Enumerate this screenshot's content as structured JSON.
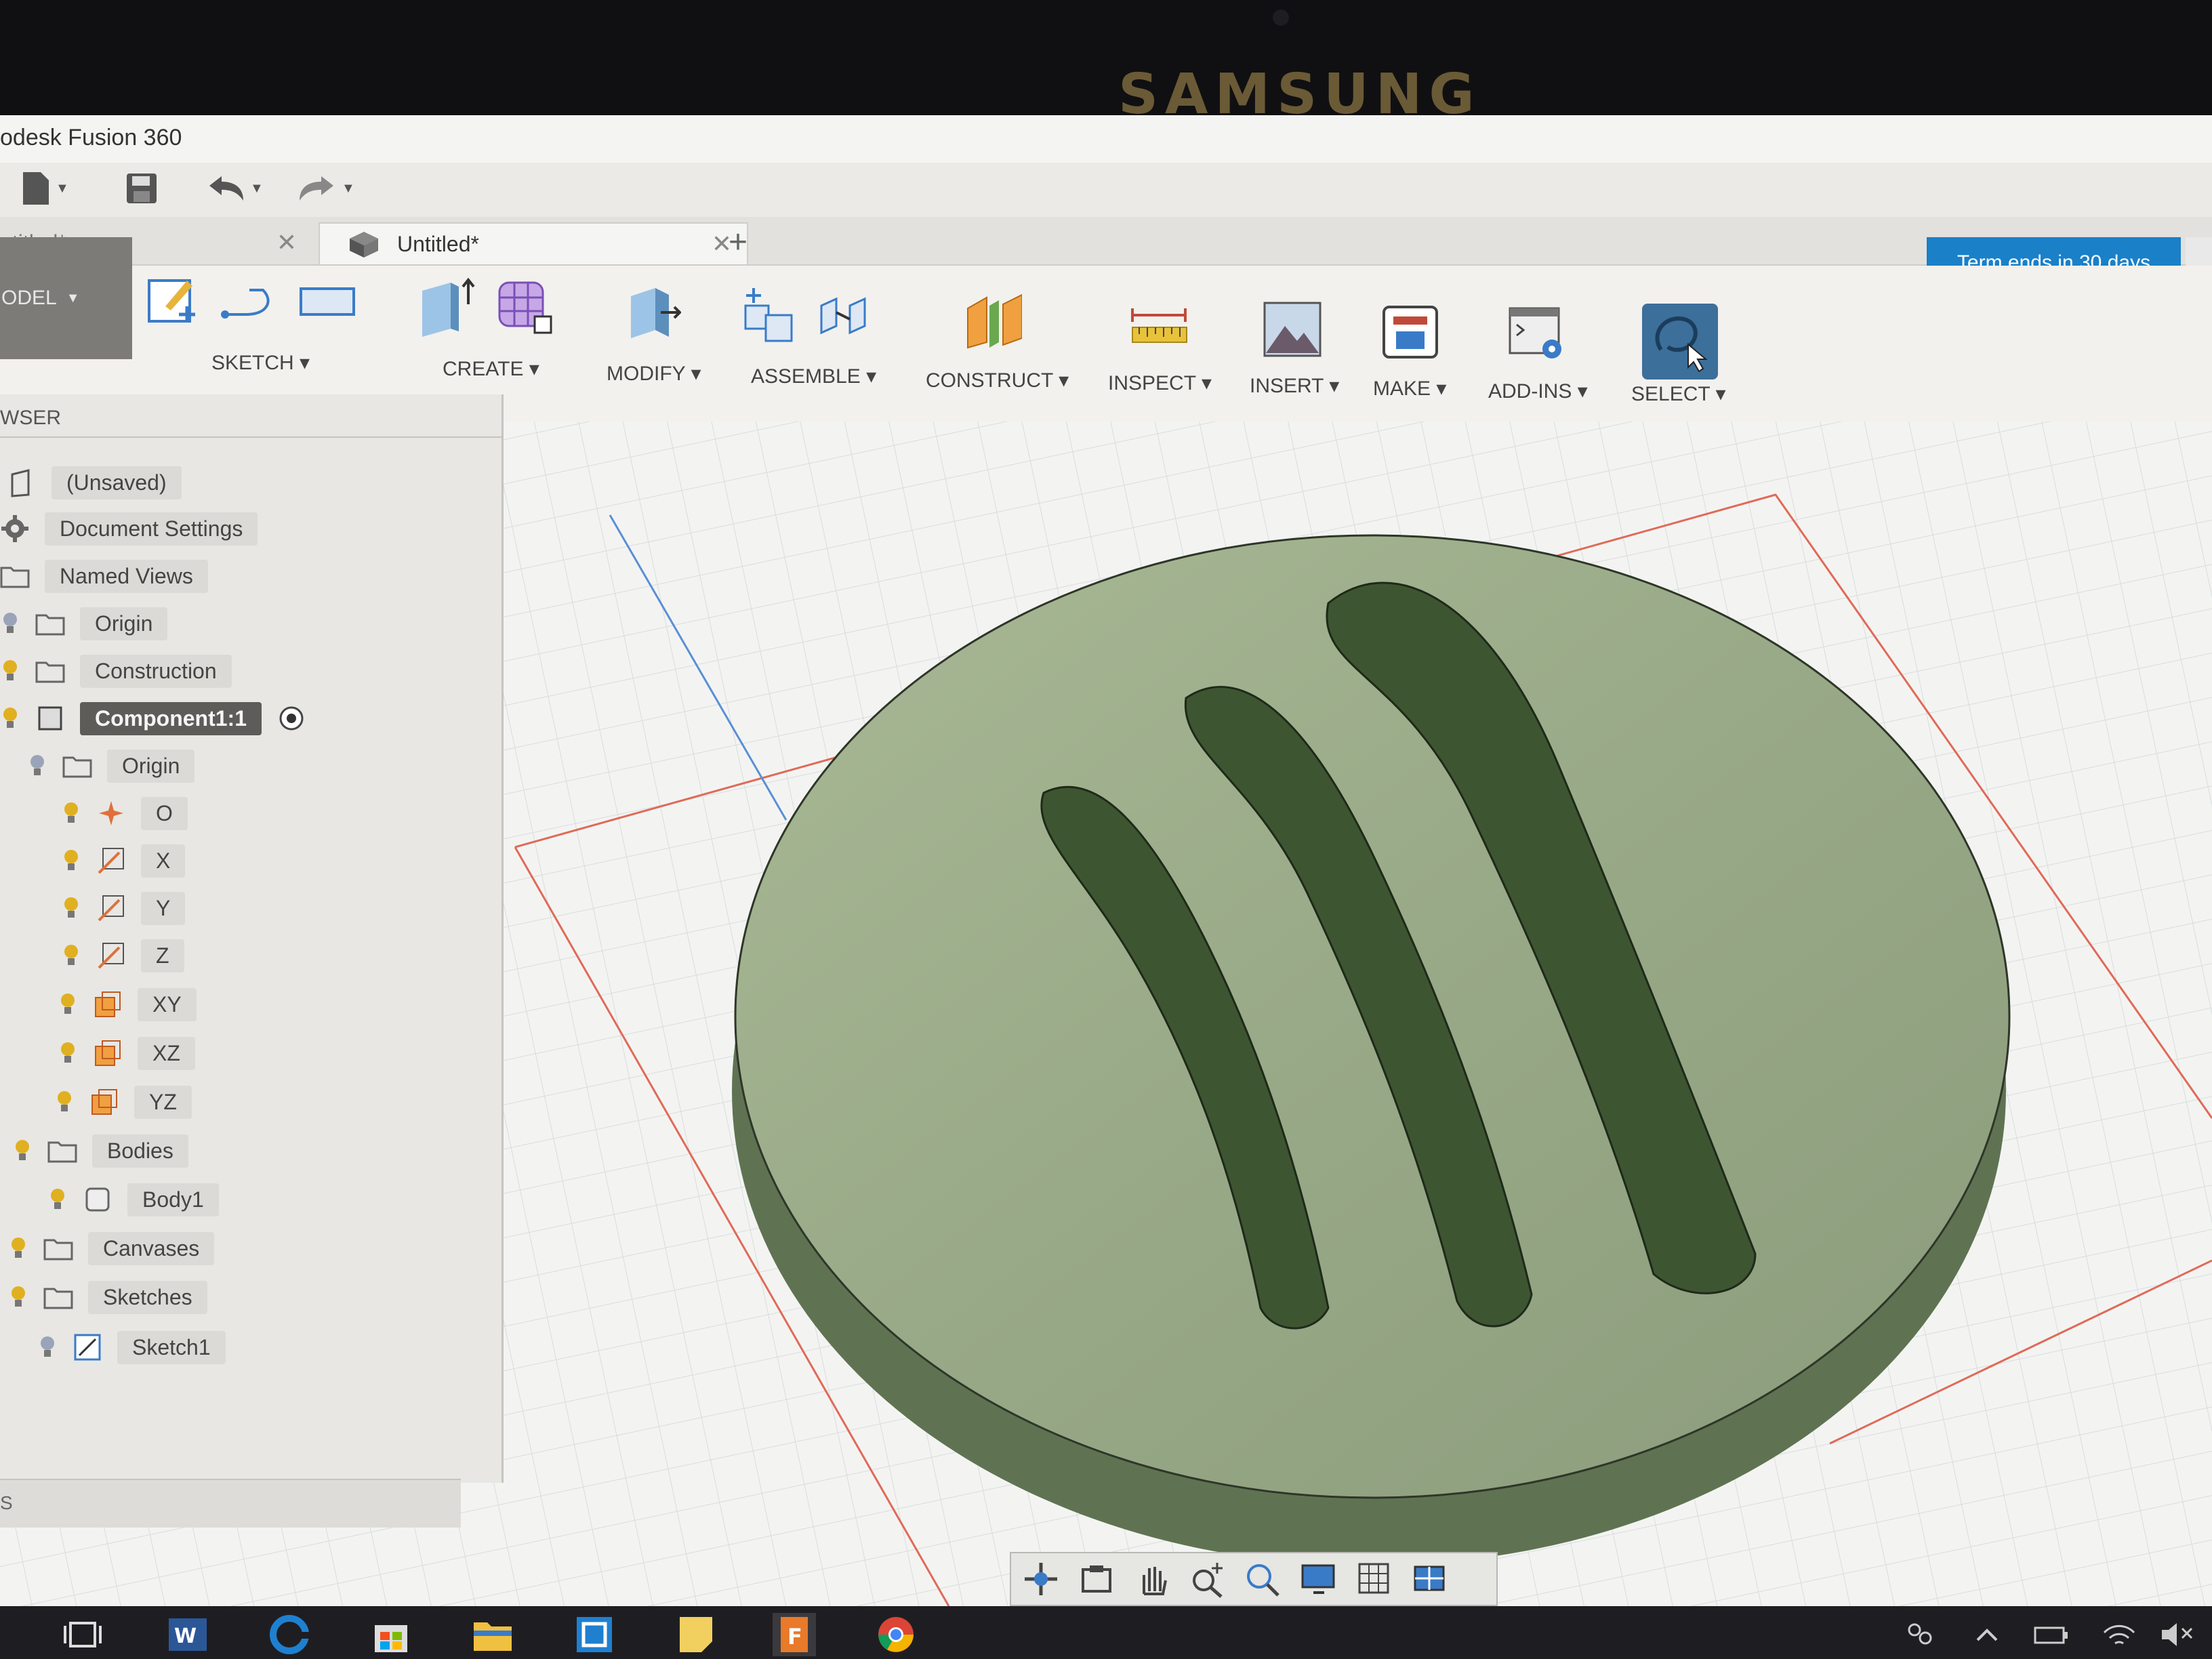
{
  "device": {
    "brand": "SAMSUNG"
  },
  "window": {
    "title": "odesk Fusion 360"
  },
  "quick_access": {
    "icons": [
      "file-menu-icon",
      "save-icon",
      "undo-icon",
      "redo-icon"
    ]
  },
  "tabs": [
    {
      "label": "ntitled*",
      "active": false
    },
    {
      "label": "Untitled*",
      "active": true
    }
  ],
  "trial_badge": "Term ends in 30 days",
  "workspace": {
    "label": "ODEL"
  },
  "toolbar": {
    "groups": [
      {
        "label": "SKETCH"
      },
      {
        "label": "CREATE"
      },
      {
        "label": "MODIFY"
      },
      {
        "label": "ASSEMBLE"
      },
      {
        "label": "CONSTRUCT"
      },
      {
        "label": "INSPECT"
      },
      {
        "label": "INSERT"
      },
      {
        "label": "MAKE"
      },
      {
        "label": "ADD-INS"
      },
      {
        "label": "SELECT"
      }
    ]
  },
  "browser": {
    "header": "WSER",
    "footer": "S",
    "items": [
      {
        "label": "(Unsaved)",
        "icon": "document-icon"
      },
      {
        "label": "Document Settings",
        "icon": "gear-icon"
      },
      {
        "label": "Named Views",
        "icon": "folder-icon"
      },
      {
        "label": "Origin",
        "icon": "folder-icon"
      },
      {
        "label": "Construction",
        "icon": "folder-icon"
      },
      {
        "label": "Component1:1",
        "icon": "component-icon",
        "active": true
      },
      {
        "label": "Origin",
        "icon": "folder-icon"
      },
      {
        "label": "O",
        "icon": "origin-point-icon"
      },
      {
        "label": "X",
        "icon": "axis-icon"
      },
      {
        "label": "Y",
        "icon": "axis-icon"
      },
      {
        "label": "Z",
        "icon": "axis-icon"
      },
      {
        "label": "XY",
        "icon": "plane-icon"
      },
      {
        "label": "XZ",
        "icon": "plane-icon"
      },
      {
        "label": "YZ",
        "icon": "plane-icon"
      },
      {
        "label": "Bodies",
        "icon": "folder-icon"
      },
      {
        "label": "Body1",
        "icon": "body-icon"
      },
      {
        "label": "Canvases",
        "icon": "folder-icon"
      },
      {
        "label": "Sketches",
        "icon": "folder-icon"
      },
      {
        "label": "Sketch1",
        "icon": "sketch-icon"
      }
    ]
  },
  "colors": {
    "trial_badge": "#1a80c8",
    "select_highlight": "#3c6f9a",
    "model_body": "#8da07a",
    "grid_red": "#e06a58",
    "grid_blue": "#5b8fd6"
  }
}
